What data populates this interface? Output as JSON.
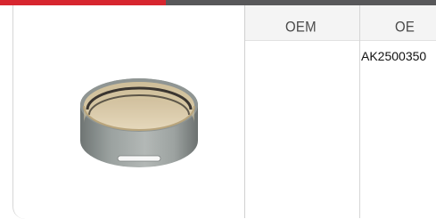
{
  "table": {
    "headers": [
      "OEM",
      "OE"
    ],
    "rows": [
      {
        "oem": "",
        "oe": "AK2500350"
      }
    ]
  },
  "product": {
    "image_icon": "bushing-ring-icon"
  },
  "colors": {
    "accent_red": "#d7262f",
    "bar_gray": "#58585a",
    "header_bg": "#f4f4f4"
  }
}
